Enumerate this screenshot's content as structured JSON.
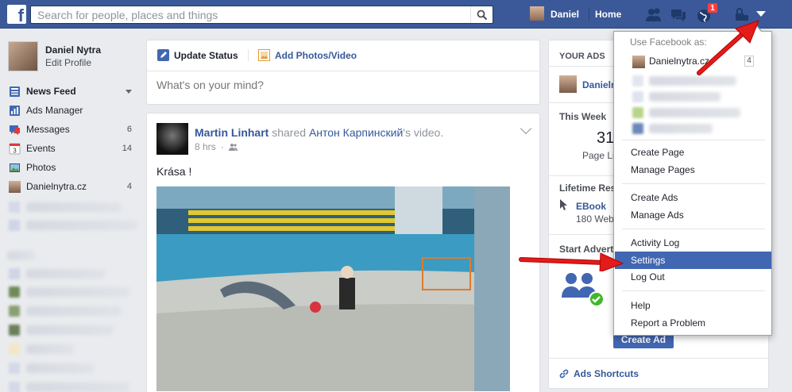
{
  "topbar": {
    "logo": "f",
    "search_placeholder": "Search for people, places and things",
    "user_name": "Daniel",
    "home_label": "Home",
    "notification_count": "1",
    "colors": {
      "bar": "#3b5998",
      "badge": "#fa3e3e"
    }
  },
  "left_nav": {
    "profile_name": "Daniel Nytra",
    "profile_edit": "Edit Profile",
    "items": [
      {
        "label": "News Feed",
        "count": "",
        "icon": "news-feed-icon"
      },
      {
        "label": "Ads Manager",
        "count": "",
        "icon": "chart-icon"
      },
      {
        "label": "Messages",
        "count": "6",
        "icon": "messages-icon"
      },
      {
        "label": "Events",
        "count": "14",
        "icon": "calendar-icon"
      },
      {
        "label": "Photos",
        "count": "",
        "icon": "photos-icon"
      },
      {
        "label": "Danielnytra.cz",
        "count": "4",
        "icon": "page-avatar"
      }
    ]
  },
  "composer": {
    "tab_status": "Update Status",
    "tab_photo": "Add Photos/Video",
    "placeholder": "What's on your mind?"
  },
  "post": {
    "author": "Martin Linhart",
    "action": "shared",
    "source": "Антон Карпинский",
    "suffix": "'s video.",
    "time": "8 hrs",
    "text": "Krása !"
  },
  "right": {
    "your_ads": "YOUR ADS",
    "ads_account": "Danielr",
    "this_week": "This Week",
    "week_number": "31",
    "week_label": "Page Li",
    "lifetime": "Lifetime Res",
    "ebook": "EBook",
    "ebook_sub": "180 Web",
    "start_advert": "Start Advert",
    "create_ad": "Create Ad",
    "ads_shortcuts": "Ads Shortcuts"
  },
  "dropdown": {
    "heading": "Use Facebook as:",
    "account_name": "Danielnytra.cz",
    "account_count": "4",
    "group1": [
      "Create Page",
      "Manage Pages"
    ],
    "group2": [
      "Create Ads",
      "Manage Ads"
    ],
    "group3": [
      "Activity Log",
      "Settings",
      "Log Out"
    ],
    "group4": [
      "Help",
      "Report a Problem"
    ],
    "selected": "Settings"
  }
}
